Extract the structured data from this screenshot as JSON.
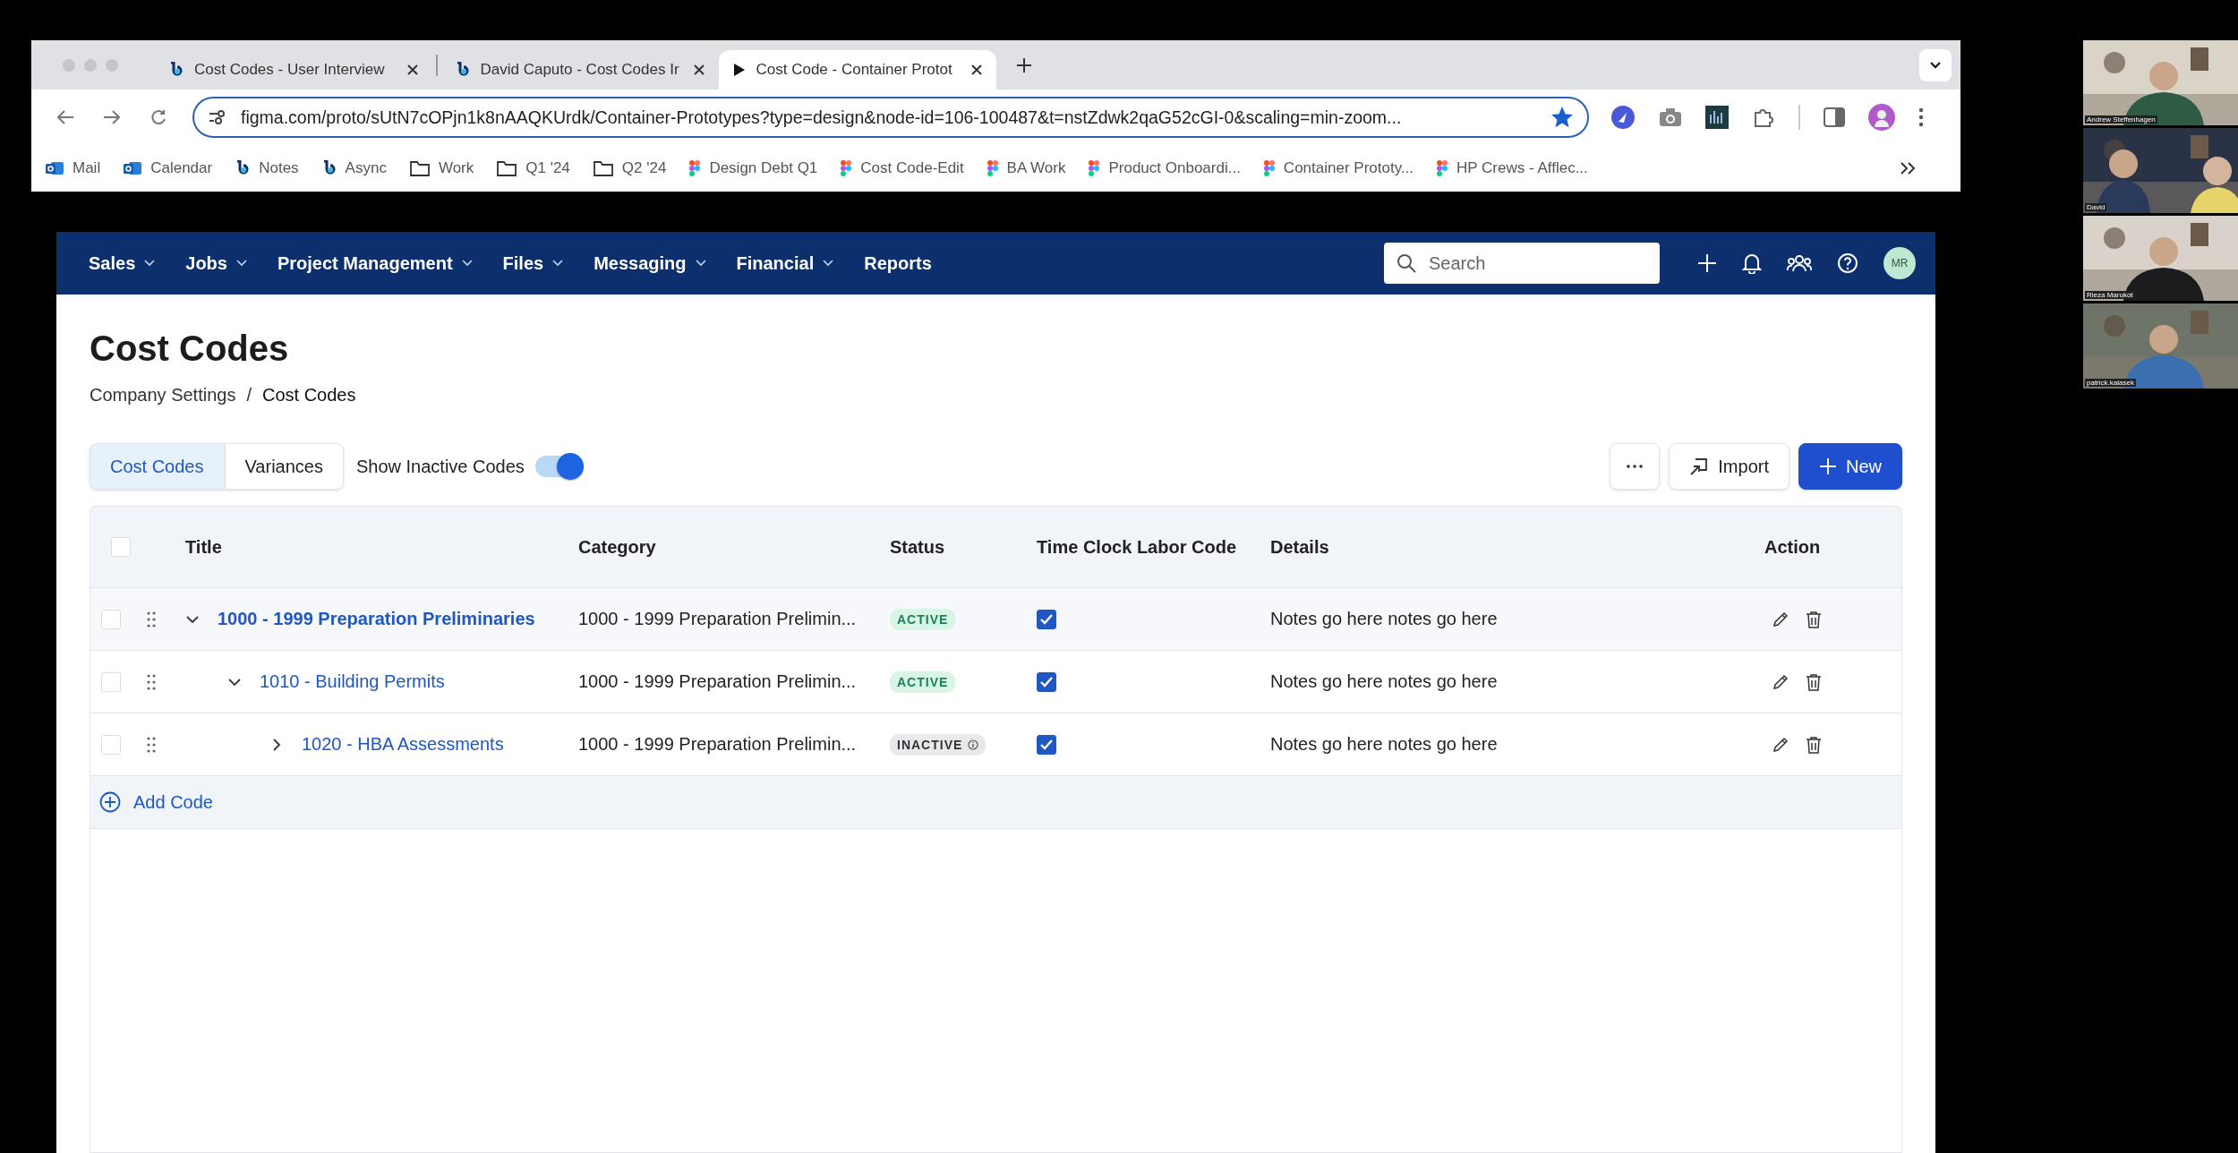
{
  "browser": {
    "tabs": [
      {
        "title": "Cost Codes - User Interview",
        "selected": false
      },
      {
        "title": "David Caputo - Cost Codes Ir",
        "selected": false
      },
      {
        "title": "Cost Code - Container Protot",
        "selected": true
      }
    ],
    "address": "figma.com/proto/sUtN7cOPjn1k8nAAQKUrdk/Container-Prototypes?type=design&node-id=106-100487&t=nstZdwk2qaG52cGI-0&scaling=min-zoom...",
    "bookmarked": true,
    "bookmarks": [
      "Mail",
      "Calendar",
      "Notes",
      "Async",
      "Work",
      "Q1 '24",
      "Q2 '24",
      "Design Debt Q1",
      "Cost Code-Edit",
      "BA Work",
      "Product Onboardi...",
      "Container Prototy...",
      "HP Crews - Afflec..."
    ]
  },
  "app": {
    "nav": [
      {
        "label": "Sales",
        "dropdown": true
      },
      {
        "label": "Jobs",
        "dropdown": true
      },
      {
        "label": "Project Management",
        "dropdown": true
      },
      {
        "label": "Files",
        "dropdown": true
      },
      {
        "label": "Messaging",
        "dropdown": true
      },
      {
        "label": "Financial",
        "dropdown": true
      },
      {
        "label": "Reports",
        "dropdown": false
      }
    ],
    "search": {
      "placeholder": "Search"
    },
    "avatar": "MR",
    "page_title": "Cost Codes",
    "breadcrumb": {
      "items": [
        "Company Settings",
        "Cost Codes"
      ],
      "separator": "/"
    },
    "view_tabs": [
      {
        "label": "Cost Codes",
        "selected": true
      },
      {
        "label": "Variances",
        "selected": false
      }
    ],
    "toggle": {
      "label": "Show Inactive Codes",
      "on": true
    },
    "actions": [
      {
        "kind": "more"
      },
      {
        "kind": "import",
        "label": "Import"
      },
      {
        "kind": "new",
        "label": "New"
      }
    ],
    "table": {
      "columns": [
        "Title",
        "Category",
        "Status",
        "Time Clock Labor Code",
        "Details",
        "Action"
      ],
      "all_selected": false,
      "rows": [
        {
          "title": "1000 - 1999 Preparation Preliminaries",
          "category": "1000 - 1999 Preparation Prelimin...",
          "status": "ACTIVE",
          "kind": "active",
          "time_clock": true,
          "details": "Notes go here notes go here",
          "selected": false,
          "expanded": true,
          "children": [
            {
              "title": "1010 - Building Permits",
              "category": "1000 - 1999 Preparation Prelimin...",
              "status": "ACTIVE",
              "kind": "active",
              "time_clock": true,
              "details": "Notes go here notes go here",
              "selected": false,
              "expanded": true,
              "children": [
                {
                  "title": "1020 - HBA  Assessments",
                  "category": "1000 - 1999 Preparation Prelimin...",
                  "status": "INACTIVE",
                  "kind": "inactive",
                  "time_clock": true,
                  "details": "Notes go here notes go here",
                  "selected": false,
                  "expanded": false
                }
              ]
            }
          ]
        }
      ],
      "add_label": "Add Code"
    }
  },
  "video_call": {
    "participants": [
      {
        "name": "Andrew Steffenhagen"
      },
      {
        "name": "David"
      },
      {
        "name": "Rieza Marukot"
      },
      {
        "name": "patrick.kalasek"
      }
    ]
  }
}
